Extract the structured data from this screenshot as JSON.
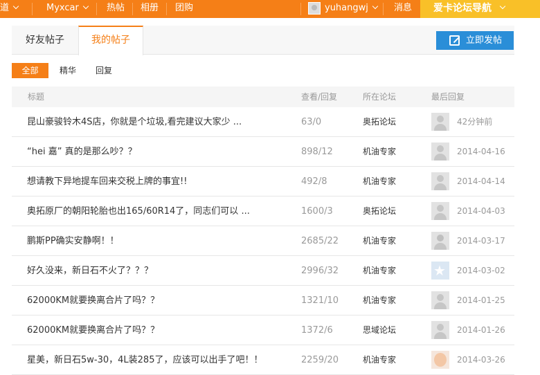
{
  "nav": {
    "items": [
      {
        "label": "道",
        "has_dropdown": true
      },
      {
        "label": "Myxcar",
        "has_dropdown": true
      },
      {
        "label": "热帖"
      },
      {
        "label": "相册"
      },
      {
        "label": "团购"
      }
    ],
    "username": "yuhangwj",
    "messages": "消息",
    "forum_nav": "爱卡论坛导航",
    "bar_color": "#f57f17",
    "forum_nav_color": "#f9c028"
  },
  "tabs": [
    {
      "label": "好友帖子"
    },
    {
      "label": "我的帖子",
      "active": true
    }
  ],
  "post_button": {
    "label": "立即发帖",
    "icon": "edit-icon",
    "color": "#2a8ed8"
  },
  "filters": [
    {
      "label": "全部",
      "active": true
    },
    {
      "label": "精华"
    },
    {
      "label": "回复"
    }
  ],
  "table": {
    "headers": {
      "title": "标题",
      "views": "查看/回复",
      "forum": "所在论坛",
      "last_reply": "最后回复"
    },
    "rows": [
      {
        "title": "昆山豪骏铃木4S店，你就是个垃圾,看完建议大家少 ...",
        "views": "63/0",
        "forum": "奥拓论坛",
        "time": "42分钟前"
      },
      {
        "title": "“hei 嘉” 真的是那么吵？？",
        "views": "898/12",
        "forum": "机油专家",
        "time": "2014-04-16"
      },
      {
        "title": "想请教下异地提车回来交税上牌的事宜!!",
        "views": "492/8",
        "forum": "机油专家",
        "time": "2014-04-14"
      },
      {
        "title": "奥拓原厂的朝阳轮胎也出165/60R14了，同志们可以 ...",
        "views": "1600/3",
        "forum": "奥拓论坛",
        "time": "2014-04-03"
      },
      {
        "title": "鹏斯PP确实安静啊！！",
        "views": "2685/22",
        "forum": "机油专家",
        "time": "2014-03-17"
      },
      {
        "title": "好久没来，新日石不火了？？？",
        "views": "2996/32",
        "forum": "机油专家",
        "time": "2014-03-02"
      },
      {
        "title": "62000KM就要换离合片了吗？？",
        "views": "1321/10",
        "forum": "机油专家",
        "time": "2014-01-25"
      },
      {
        "title": "62000KM就要换离合片了吗？？",
        "views": "1372/6",
        "forum": "思域论坛",
        "time": "2014-01-26"
      },
      {
        "title": "星美，新日石5w-30，4L装285了，应该可以出手了吧！！",
        "views": "2259/20",
        "forum": "机油专家",
        "time": "2014-03-26"
      }
    ]
  }
}
